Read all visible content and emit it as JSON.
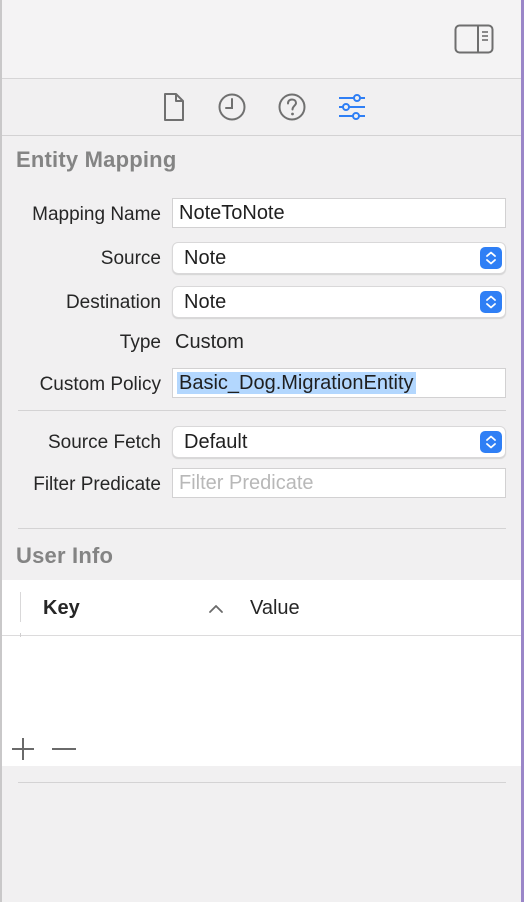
{
  "tabs": [
    {
      "name": "file-inspector",
      "icon": "document-icon",
      "active": false
    },
    {
      "name": "history-inspector",
      "icon": "clock-icon",
      "active": false
    },
    {
      "name": "quick-help",
      "icon": "question-icon",
      "active": false
    },
    {
      "name": "attributes-inspector",
      "icon": "sliders-icon",
      "active": true
    }
  ],
  "entity_mapping": {
    "title": "Entity Mapping",
    "mapping_name_label": "Mapping Name",
    "mapping_name_value": "NoteToNote",
    "source_label": "Source",
    "source_value": "Note",
    "destination_label": "Destination",
    "destination_value": "Note",
    "type_label": "Type",
    "type_value": "Custom",
    "custom_policy_label": "Custom Policy",
    "custom_policy_value": "Basic_Dog.MigrationEntity",
    "source_fetch_label": "Source Fetch",
    "source_fetch_value": "Default",
    "filter_predicate_label": "Filter Predicate",
    "filter_predicate_placeholder": "Filter Predicate"
  },
  "user_info": {
    "title": "User Info",
    "columns": {
      "key": "Key",
      "value": "Value"
    },
    "rows": []
  },
  "colors": {
    "accent": "#2f7ff5",
    "selection": "#b3d7fe",
    "section_title": "#848484"
  }
}
